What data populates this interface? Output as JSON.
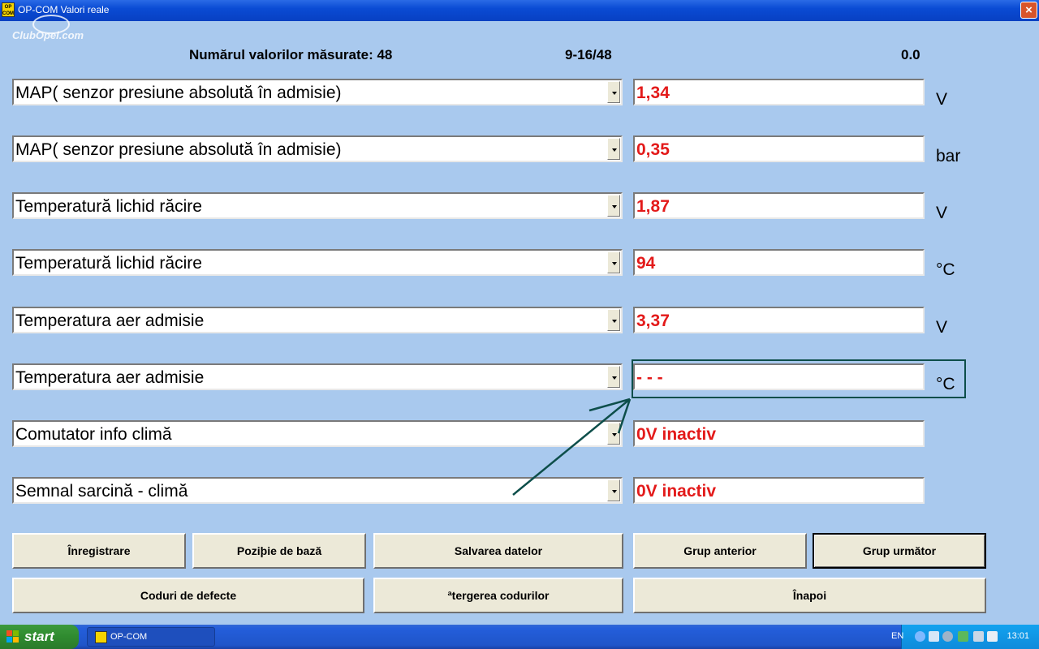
{
  "window": {
    "title": "OP-COM  Valori reale",
    "close": "×",
    "app_icon_text": "OP COM"
  },
  "watermark": "ClubOpel.com",
  "header": {
    "count_label": "Numărul valorilor măsurate: 48",
    "range": "9-16/48",
    "extra_value": "0.0"
  },
  "rows": [
    {
      "name": "MAP( senzor presiune absolută în admisie)",
      "value": "1,34",
      "unit": "V"
    },
    {
      "name": "MAP( senzor presiune absolută în admisie)",
      "value": "0,35",
      "unit": "bar"
    },
    {
      "name": "Temperatură lichid răcire",
      "value": "1,87",
      "unit": "V"
    },
    {
      "name": "Temperatură lichid răcire",
      "value": "94",
      "unit": "°C"
    },
    {
      "name": "Temperatura aer admisie",
      "value": "3,37",
      "unit": "V"
    },
    {
      "name": "Temperatura aer admisie",
      "value": "- - -",
      "unit": "°C"
    },
    {
      "name": "Comutator info climă",
      "value": "0V inactiv",
      "unit": ""
    },
    {
      "name": "Semnal sarcină - climă",
      "value": "0V inactiv",
      "unit": ""
    }
  ],
  "buttons": {
    "record": "Înregistrare",
    "base_position": "Poziþie de bază",
    "save_data": "Salvarea datelor",
    "prev_group": "Grup anterior",
    "next_group": "Grup următor",
    "fault_codes": "Coduri de defecte",
    "clear_codes": "ªtergerea codurilor",
    "back": "Înapoi"
  },
  "taskbar": {
    "start": "start",
    "task": "OP-COM",
    "lang": "EN",
    "clock": "13:01"
  },
  "colors": {
    "background": "#a9c9ee",
    "value_text": "#e31a1a",
    "highlight": "#0d4e4a"
  }
}
